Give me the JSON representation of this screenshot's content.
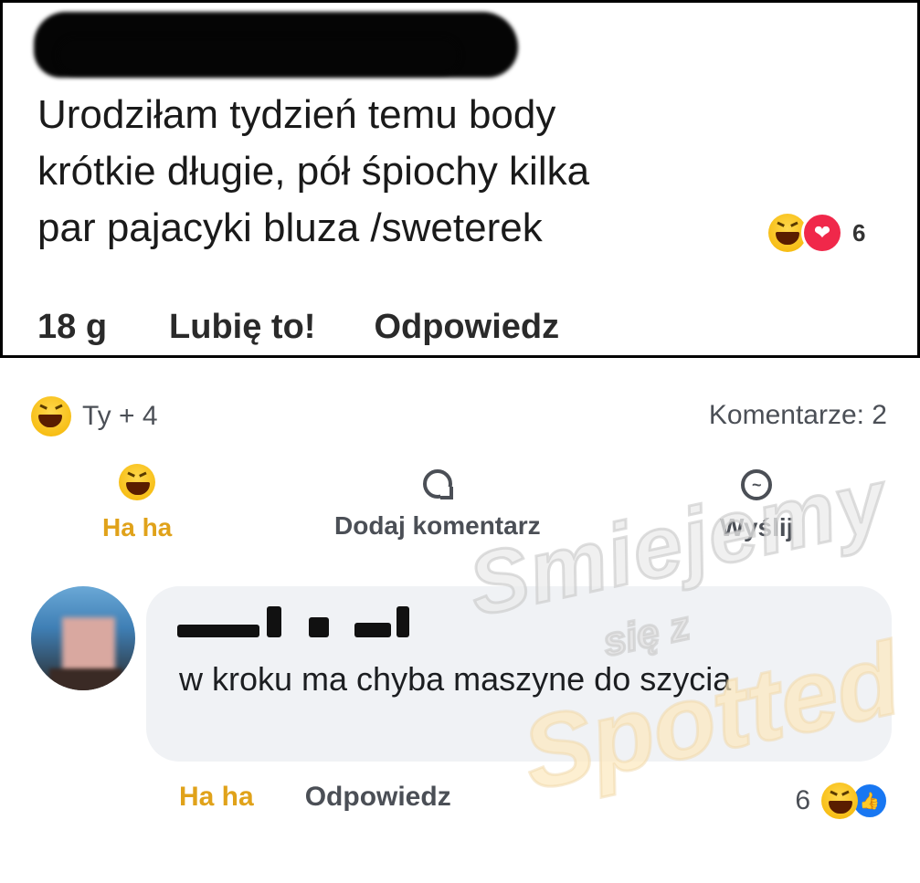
{
  "original_comment": {
    "text_lines": [
      "Urodziłam tydzień temu body",
      "krótkie długie, pół śpiochy kilka",
      "par pajacyki bluza /sweterek"
    ],
    "reaction_count": "6",
    "time": "18 g",
    "like_label": "Lubię to!",
    "reply_label": "Odpowiedz"
  },
  "post": {
    "reactions_summary": "Ty + 4",
    "comments_count": "Komentarze: 2",
    "actions": {
      "haha": "Ha ha",
      "comment": "Dodaj komentarz",
      "send": "Wyślij"
    }
  },
  "reply_comment": {
    "text": "w kroku ma chyba maszyne do szycia",
    "haha_label": "Ha ha",
    "reply_label": "Odpowiedz",
    "reaction_count": "6"
  },
  "watermark": {
    "line1": "Smiejemy",
    "line2": "się z",
    "line3": "Spotted"
  },
  "colors": {
    "haha_accent": "#e0a21a",
    "love_red": "#f0284a",
    "like_blue": "#1877f2",
    "bubble_bg": "#f0f2f5"
  },
  "icons": [
    "haha-emoji-icon",
    "love-heart-icon",
    "comment-bubble-icon",
    "messenger-icon",
    "like-thumb-icon"
  ]
}
